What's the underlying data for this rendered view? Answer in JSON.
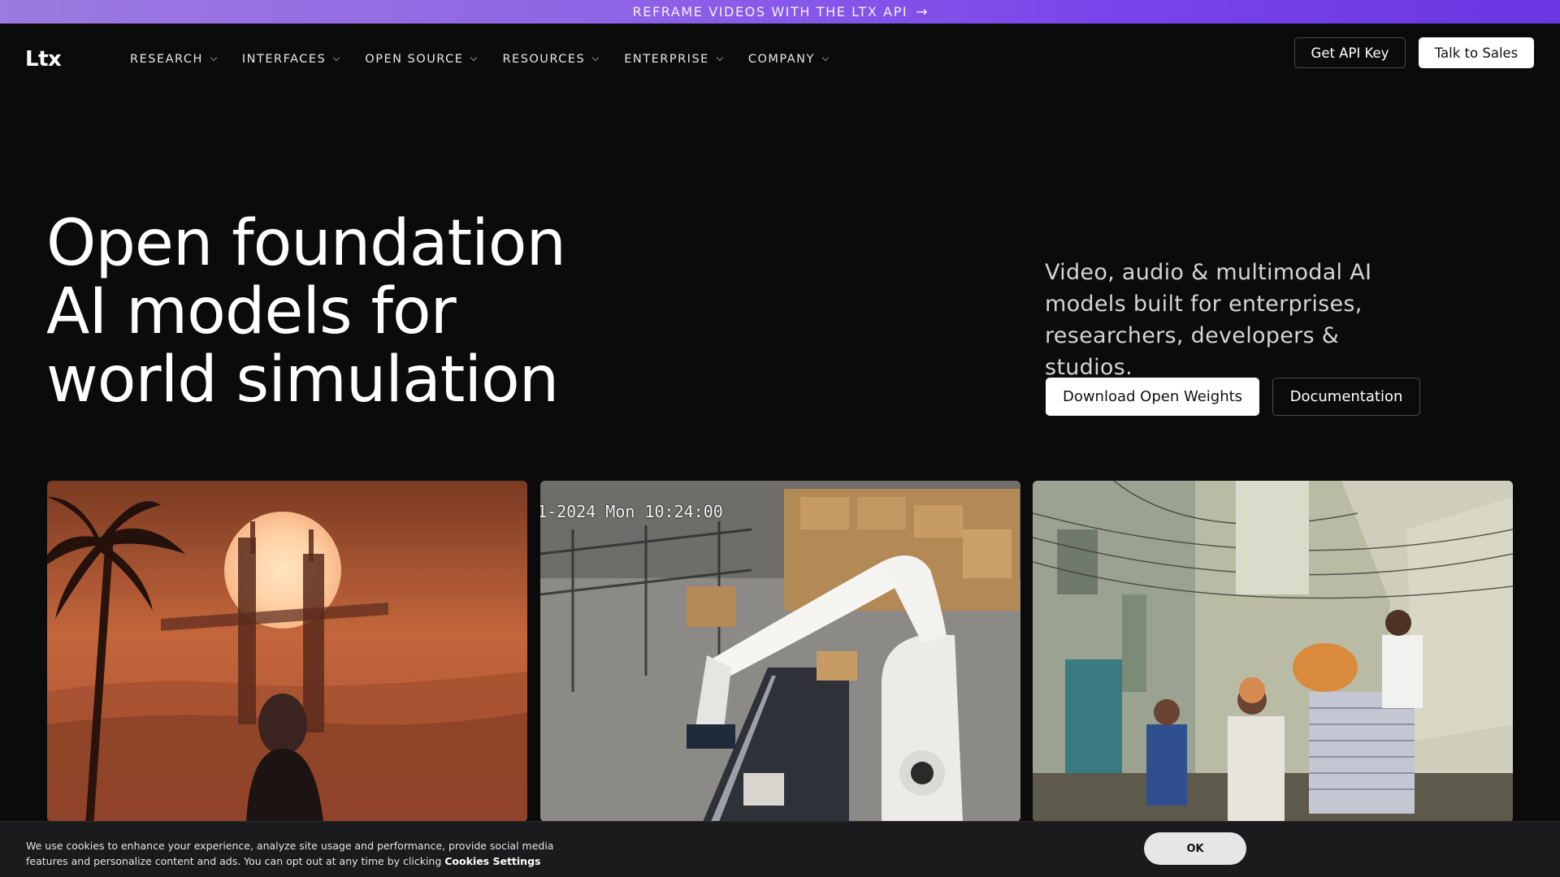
{
  "banner": {
    "text": "REFRAME VIDEOS WITH THE LTX API",
    "arrow": "→"
  },
  "nav": {
    "logo": "Ltx",
    "menu": [
      {
        "label": "RESEARCH"
      },
      {
        "label": "INTERFACES"
      },
      {
        "label": "OPEN SOURCE"
      },
      {
        "label": "RESOURCES"
      },
      {
        "label": "ENTERPRISE"
      },
      {
        "label": "COMPANY"
      }
    ],
    "api_key_label": "Get API Key",
    "sales_label": "Talk to Sales"
  },
  "hero": {
    "title_lines": [
      "Open foundation",
      "AI models for",
      "world simulation"
    ],
    "subtitle": "Video, audio & multimodal AI models built for enterprises, researchers, developers & studios.",
    "primary_cta": "Download Open Weights",
    "secondary_cta": "Documentation"
  },
  "media": {
    "cards": [
      {
        "name": "desert-futuristic-city-video"
      },
      {
        "name": "warehouse-robot-arm-video",
        "overlay_text": "1-2024 Mon 10:24:00"
      },
      {
        "name": "street-worker-paper-stack-video"
      }
    ]
  },
  "cookie": {
    "text": "We use cookies to enhance your experience, analyze site usage and performance, provide social media features and personalize content and ads. You can opt out at any time by clicking ",
    "link_label": "Cookies Settings",
    "ok_label": "OK"
  },
  "colors": {
    "background": "#0b0b0c",
    "banner_gradient_start": "#9b7be0",
    "banner_gradient_end": "#6a36e2",
    "primary_button": "#ffffff",
    "cookie_bar": "#1b1b1d"
  }
}
